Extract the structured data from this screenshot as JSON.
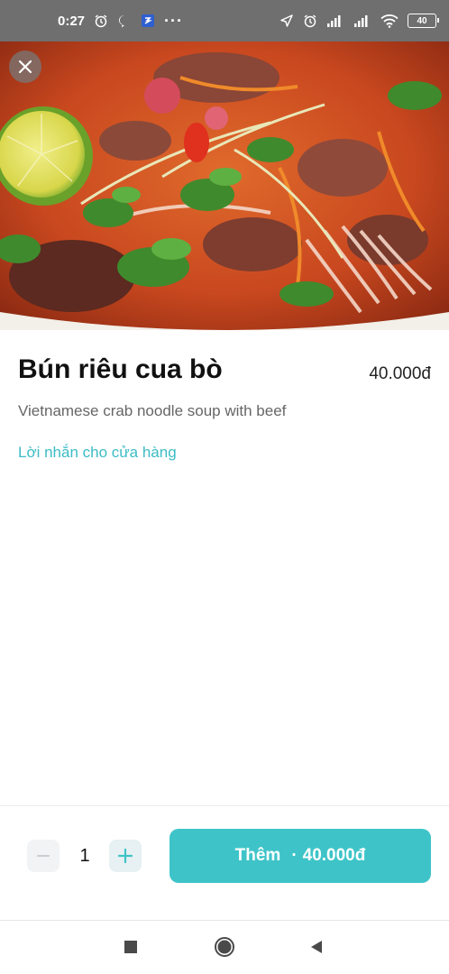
{
  "status_bar": {
    "time": "0:27",
    "more": "···",
    "battery": "40",
    "icons": [
      "alarm-icon",
      "chat-bubble-icon",
      "app-badge-icon",
      "location-arrow-icon",
      "alarm-icon",
      "signal-icon",
      "signal-icon",
      "wifi-icon",
      "battery-icon"
    ]
  },
  "product": {
    "name": "Bún riêu cua bò",
    "price": "40.000đ",
    "description": "Vietnamese crab noodle soup with beef",
    "note_link": "Lời nhắn cho cửa hàng"
  },
  "cart": {
    "quantity": "1",
    "add_label": "Thêm",
    "add_separator": "·",
    "add_total": "40.000đ"
  },
  "colors": {
    "accent": "#3ec4c8",
    "link": "#3cbcc4",
    "status_bar": "#6f6f6f"
  },
  "nav": {
    "icons": [
      "recent-apps-icon",
      "home-icon",
      "back-icon"
    ]
  }
}
